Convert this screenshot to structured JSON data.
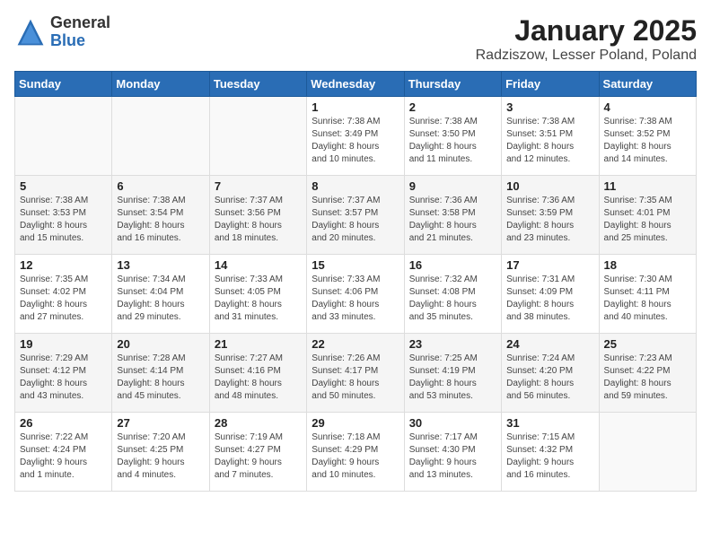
{
  "logo": {
    "general": "General",
    "blue": "Blue"
  },
  "header": {
    "month": "January 2025",
    "location": "Radziszow, Lesser Poland, Poland"
  },
  "weekdays": [
    "Sunday",
    "Monday",
    "Tuesday",
    "Wednesday",
    "Thursday",
    "Friday",
    "Saturday"
  ],
  "weeks": [
    [
      {
        "day": "",
        "info": ""
      },
      {
        "day": "",
        "info": ""
      },
      {
        "day": "",
        "info": ""
      },
      {
        "day": "1",
        "info": "Sunrise: 7:38 AM\nSunset: 3:49 PM\nDaylight: 8 hours\nand 10 minutes."
      },
      {
        "day": "2",
        "info": "Sunrise: 7:38 AM\nSunset: 3:50 PM\nDaylight: 8 hours\nand 11 minutes."
      },
      {
        "day": "3",
        "info": "Sunrise: 7:38 AM\nSunset: 3:51 PM\nDaylight: 8 hours\nand 12 minutes."
      },
      {
        "day": "4",
        "info": "Sunrise: 7:38 AM\nSunset: 3:52 PM\nDaylight: 8 hours\nand 14 minutes."
      }
    ],
    [
      {
        "day": "5",
        "info": "Sunrise: 7:38 AM\nSunset: 3:53 PM\nDaylight: 8 hours\nand 15 minutes."
      },
      {
        "day": "6",
        "info": "Sunrise: 7:38 AM\nSunset: 3:54 PM\nDaylight: 8 hours\nand 16 minutes."
      },
      {
        "day": "7",
        "info": "Sunrise: 7:37 AM\nSunset: 3:56 PM\nDaylight: 8 hours\nand 18 minutes."
      },
      {
        "day": "8",
        "info": "Sunrise: 7:37 AM\nSunset: 3:57 PM\nDaylight: 8 hours\nand 20 minutes."
      },
      {
        "day": "9",
        "info": "Sunrise: 7:36 AM\nSunset: 3:58 PM\nDaylight: 8 hours\nand 21 minutes."
      },
      {
        "day": "10",
        "info": "Sunrise: 7:36 AM\nSunset: 3:59 PM\nDaylight: 8 hours\nand 23 minutes."
      },
      {
        "day": "11",
        "info": "Sunrise: 7:35 AM\nSunset: 4:01 PM\nDaylight: 8 hours\nand 25 minutes."
      }
    ],
    [
      {
        "day": "12",
        "info": "Sunrise: 7:35 AM\nSunset: 4:02 PM\nDaylight: 8 hours\nand 27 minutes."
      },
      {
        "day": "13",
        "info": "Sunrise: 7:34 AM\nSunset: 4:04 PM\nDaylight: 8 hours\nand 29 minutes."
      },
      {
        "day": "14",
        "info": "Sunrise: 7:33 AM\nSunset: 4:05 PM\nDaylight: 8 hours\nand 31 minutes."
      },
      {
        "day": "15",
        "info": "Sunrise: 7:33 AM\nSunset: 4:06 PM\nDaylight: 8 hours\nand 33 minutes."
      },
      {
        "day": "16",
        "info": "Sunrise: 7:32 AM\nSunset: 4:08 PM\nDaylight: 8 hours\nand 35 minutes."
      },
      {
        "day": "17",
        "info": "Sunrise: 7:31 AM\nSunset: 4:09 PM\nDaylight: 8 hours\nand 38 minutes."
      },
      {
        "day": "18",
        "info": "Sunrise: 7:30 AM\nSunset: 4:11 PM\nDaylight: 8 hours\nand 40 minutes."
      }
    ],
    [
      {
        "day": "19",
        "info": "Sunrise: 7:29 AM\nSunset: 4:12 PM\nDaylight: 8 hours\nand 43 minutes."
      },
      {
        "day": "20",
        "info": "Sunrise: 7:28 AM\nSunset: 4:14 PM\nDaylight: 8 hours\nand 45 minutes."
      },
      {
        "day": "21",
        "info": "Sunrise: 7:27 AM\nSunset: 4:16 PM\nDaylight: 8 hours\nand 48 minutes."
      },
      {
        "day": "22",
        "info": "Sunrise: 7:26 AM\nSunset: 4:17 PM\nDaylight: 8 hours\nand 50 minutes."
      },
      {
        "day": "23",
        "info": "Sunrise: 7:25 AM\nSunset: 4:19 PM\nDaylight: 8 hours\nand 53 minutes."
      },
      {
        "day": "24",
        "info": "Sunrise: 7:24 AM\nSunset: 4:20 PM\nDaylight: 8 hours\nand 56 minutes."
      },
      {
        "day": "25",
        "info": "Sunrise: 7:23 AM\nSunset: 4:22 PM\nDaylight: 8 hours\nand 59 minutes."
      }
    ],
    [
      {
        "day": "26",
        "info": "Sunrise: 7:22 AM\nSunset: 4:24 PM\nDaylight: 9 hours\nand 1 minute."
      },
      {
        "day": "27",
        "info": "Sunrise: 7:20 AM\nSunset: 4:25 PM\nDaylight: 9 hours\nand 4 minutes."
      },
      {
        "day": "28",
        "info": "Sunrise: 7:19 AM\nSunset: 4:27 PM\nDaylight: 9 hours\nand 7 minutes."
      },
      {
        "day": "29",
        "info": "Sunrise: 7:18 AM\nSunset: 4:29 PM\nDaylight: 9 hours\nand 10 minutes."
      },
      {
        "day": "30",
        "info": "Sunrise: 7:17 AM\nSunset: 4:30 PM\nDaylight: 9 hours\nand 13 minutes."
      },
      {
        "day": "31",
        "info": "Sunrise: 7:15 AM\nSunset: 4:32 PM\nDaylight: 9 hours\nand 16 minutes."
      },
      {
        "day": "",
        "info": ""
      }
    ]
  ]
}
